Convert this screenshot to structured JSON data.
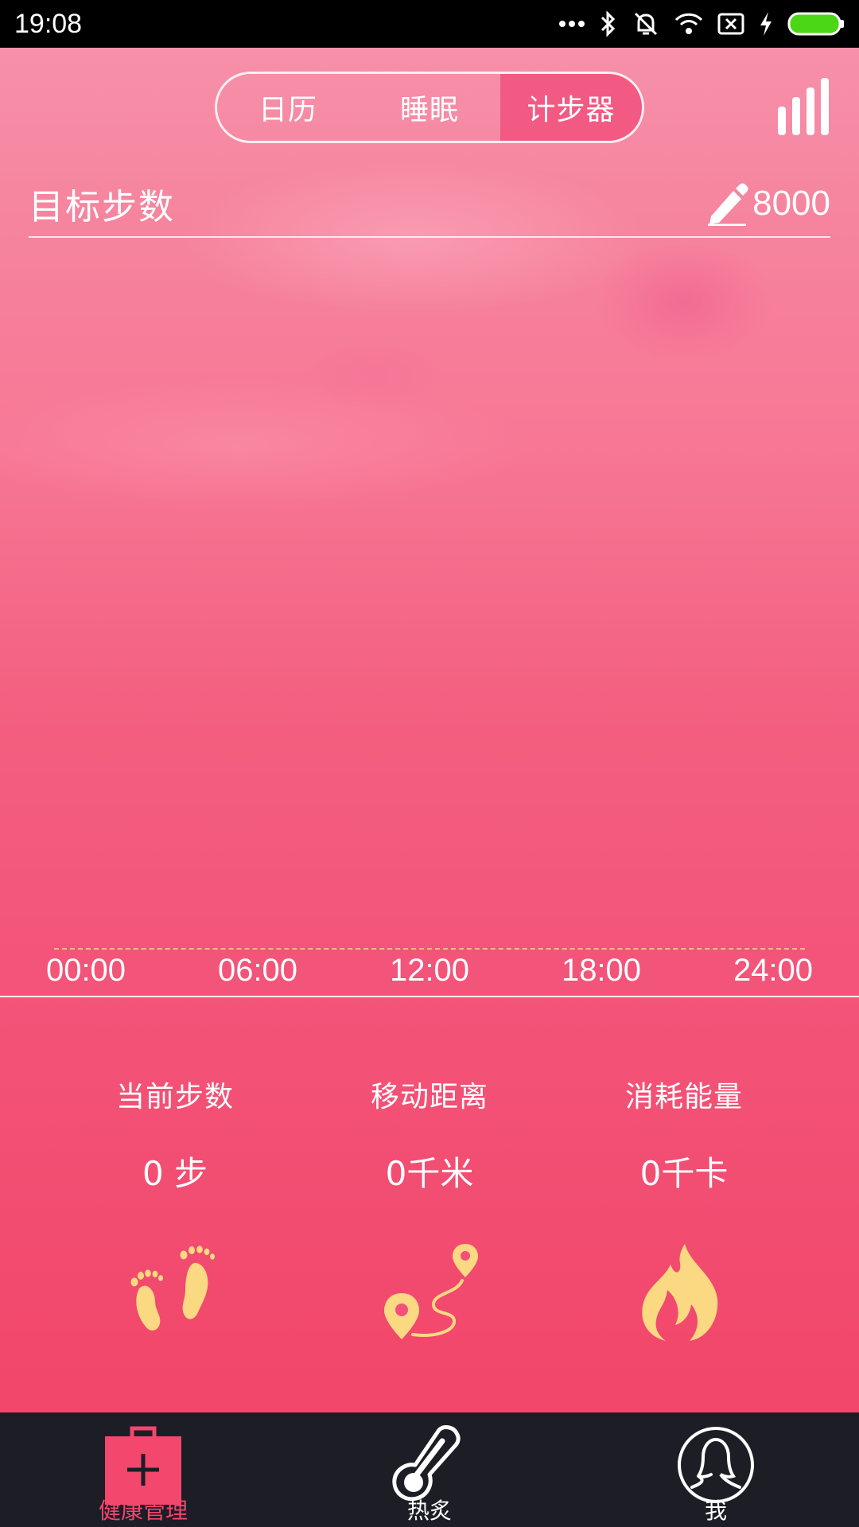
{
  "status_bar": {
    "time": "19:08"
  },
  "header": {
    "tabs": [
      {
        "label": "日历",
        "active": false
      },
      {
        "label": "睡眠",
        "active": false
      },
      {
        "label": "计步器",
        "active": true
      }
    ],
    "right_icon": "bar-chart-icon"
  },
  "target": {
    "label": "目标步数",
    "value": "8000",
    "edit_icon": "pencil-icon"
  },
  "timeline": {
    "ticks": [
      "00:00",
      "06:00",
      "12:00",
      "18:00",
      "24:00"
    ]
  },
  "stats": [
    {
      "label": "当前步数",
      "value": "0 步",
      "icon": "footprints-icon"
    },
    {
      "label": "移动距离",
      "value": "0千米",
      "icon": "route-pin-icon"
    },
    {
      "label": "消耗能量",
      "value": "0千卡",
      "icon": "flame-icon"
    }
  ],
  "bottom_nav": [
    {
      "label": "健康管理",
      "icon": "medical-kit-icon",
      "active": true
    },
    {
      "label": "热炙",
      "icon": "thermometer-icon",
      "active": false
    },
    {
      "label": "我",
      "icon": "user-profile-icon",
      "active": false
    }
  ],
  "colors": {
    "accent": "#f3476d",
    "active_tab": "#f25a83",
    "icon_yellow": "#fbd882",
    "nav_background": "#1d1d26"
  }
}
